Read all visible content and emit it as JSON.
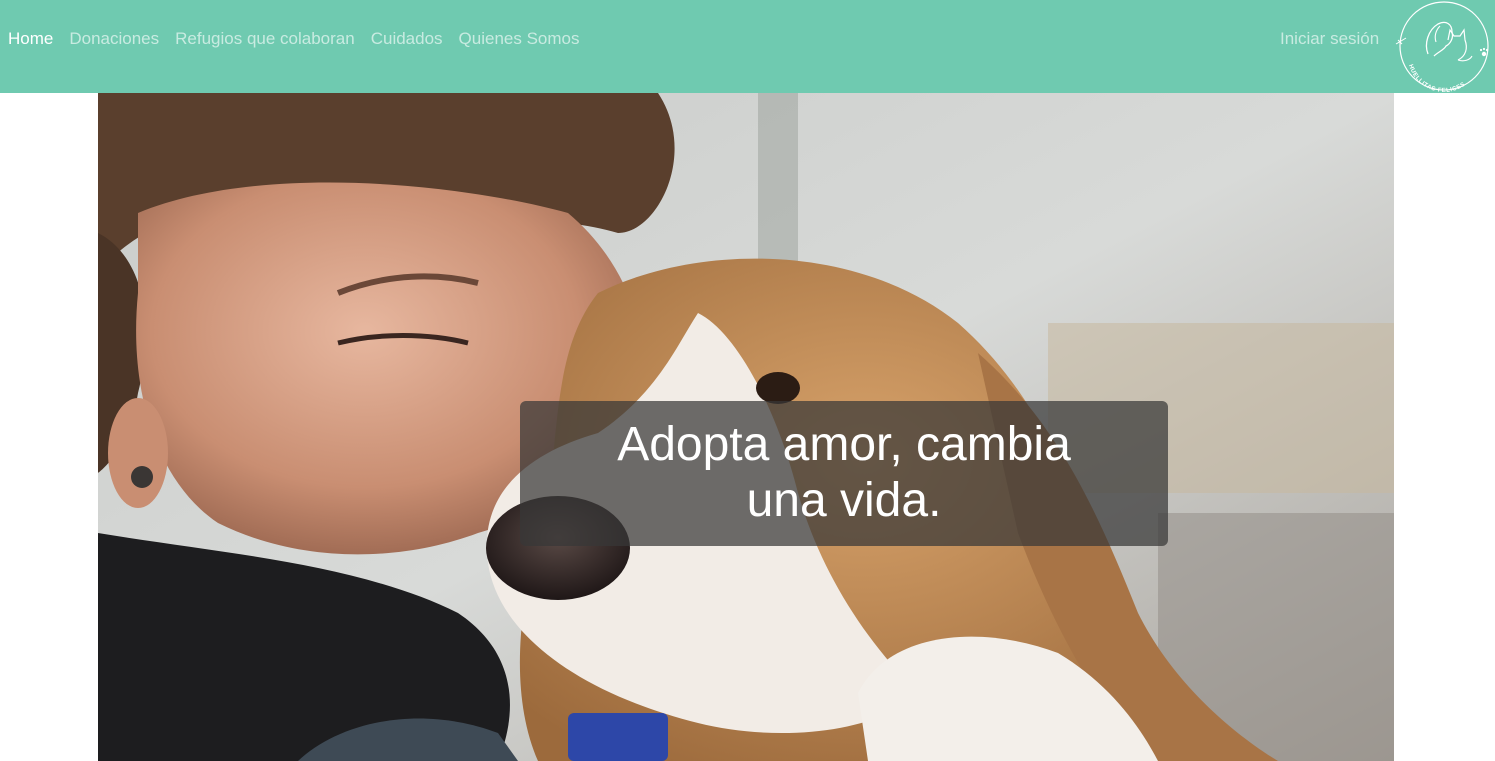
{
  "nav": {
    "items": [
      {
        "label": "Home",
        "active": true
      },
      {
        "label": "Donaciones",
        "active": false
      },
      {
        "label": "Refugios que colaboran",
        "active": false
      },
      {
        "label": "Cuidados",
        "active": false
      },
      {
        "label": "Quienes Somos",
        "active": false
      }
    ],
    "login_label": "Iniciar sesión",
    "logo_icon": "dog-and-cat-logo-icon",
    "logo_text": "HUELLITAS FELICES"
  },
  "hero": {
    "image": "woman-kissing-beagle-photo",
    "caption_line1": "Adopta amor, cambia",
    "caption_line2": "una vida."
  },
  "colors": {
    "navbar": "#6fcab0",
    "nav_text_active": "#ffffff",
    "nav_text_inactive": "#e4f5ef",
    "caption_bg": "#373737"
  }
}
